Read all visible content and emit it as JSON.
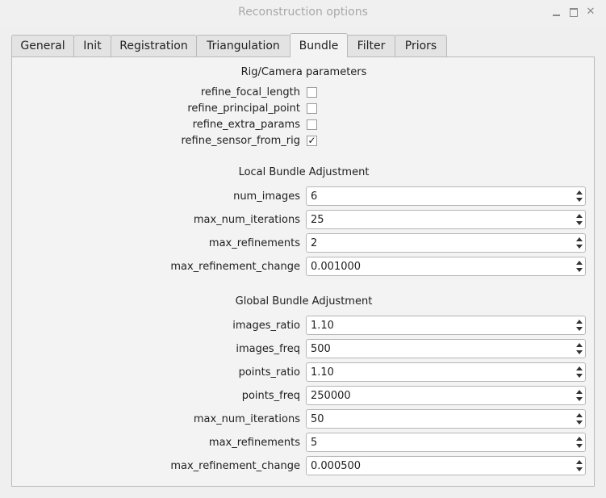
{
  "window": {
    "title": "Reconstruction options"
  },
  "tabs": [
    "General",
    "Init",
    "Registration",
    "Triangulation",
    "Bundle",
    "Filter",
    "Priors"
  ],
  "active_tab": "Bundle",
  "rig_camera": {
    "title": "Rig/Camera parameters",
    "checks": [
      {
        "label": "refine_focal_length",
        "checked": false
      },
      {
        "label": "refine_principal_point",
        "checked": false
      },
      {
        "label": "refine_extra_params",
        "checked": false
      },
      {
        "label": "refine_sensor_from_rig",
        "checked": true
      }
    ]
  },
  "local_ba": {
    "title": "Local Bundle Adjustment",
    "fields": [
      {
        "label": "num_images",
        "value": "6"
      },
      {
        "label": "max_num_iterations",
        "value": "25"
      },
      {
        "label": "max_refinements",
        "value": "2"
      },
      {
        "label": "max_refinement_change",
        "value": "0.001000"
      }
    ]
  },
  "global_ba": {
    "title": "Global Bundle Adjustment",
    "fields": [
      {
        "label": "images_ratio",
        "value": "1.10"
      },
      {
        "label": "images_freq",
        "value": "500"
      },
      {
        "label": "points_ratio",
        "value": "1.10"
      },
      {
        "label": "points_freq",
        "value": "250000"
      },
      {
        "label": "max_num_iterations",
        "value": "50"
      },
      {
        "label": "max_refinements",
        "value": "5"
      },
      {
        "label": "max_refinement_change",
        "value": "0.000500"
      }
    ]
  }
}
